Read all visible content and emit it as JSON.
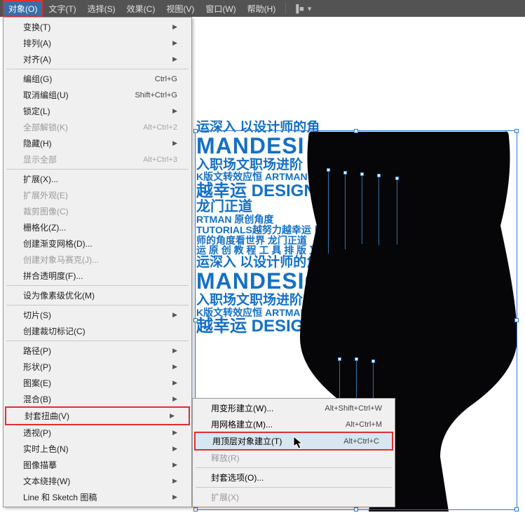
{
  "menubar": {
    "items": [
      {
        "label": "对象(O)",
        "active": true
      },
      {
        "label": "文字(T)"
      },
      {
        "label": "选择(S)"
      },
      {
        "label": "效果(C)"
      },
      {
        "label": "视图(V)"
      },
      {
        "label": "窗口(W)"
      },
      {
        "label": "帮助(H)"
      }
    ]
  },
  "dropdown": {
    "items": [
      {
        "label": "变换(T)",
        "sub": true
      },
      {
        "label": "排列(A)",
        "sub": true
      },
      {
        "label": "对齐(A)",
        "sub": true
      },
      {
        "sep": true
      },
      {
        "label": "编组(G)",
        "shortcut": "Ctrl+G"
      },
      {
        "label": "取消编组(U)",
        "shortcut": "Shift+Ctrl+G"
      },
      {
        "label": "锁定(L)",
        "sub": true
      },
      {
        "label": "全部解锁(K)",
        "shortcut": "Alt+Ctrl+2",
        "disabled": true
      },
      {
        "label": "隐藏(H)",
        "sub": true
      },
      {
        "label": "显示全部",
        "shortcut": "Alt+Ctrl+3",
        "disabled": true
      },
      {
        "sep": true
      },
      {
        "label": "扩展(X)..."
      },
      {
        "label": "扩展外观(E)",
        "disabled": true
      },
      {
        "label": "裁剪图像(C)",
        "disabled": true
      },
      {
        "label": "栅格化(Z)..."
      },
      {
        "label": "创建渐变网格(D)..."
      },
      {
        "label": "创建对象马赛克(J)...",
        "disabled": true
      },
      {
        "label": "拼合透明度(F)..."
      },
      {
        "sep": true
      },
      {
        "label": "设为像素级优化(M)"
      },
      {
        "sep": true
      },
      {
        "label": "切片(S)",
        "sub": true
      },
      {
        "label": "创建裁切标记(C)"
      },
      {
        "sep": true
      },
      {
        "label": "路径(P)",
        "sub": true
      },
      {
        "label": "形状(P)",
        "sub": true
      },
      {
        "label": "图案(E)",
        "sub": true
      },
      {
        "label": "混合(B)",
        "sub": true
      },
      {
        "label": "封套扭曲(V)",
        "sub": true,
        "highlight": true
      },
      {
        "label": "透视(P)",
        "sub": true
      },
      {
        "label": "实时上色(N)",
        "sub": true
      },
      {
        "label": "图像描摹",
        "sub": true
      },
      {
        "label": "文本绕排(W)",
        "sub": true
      },
      {
        "label": "Line 和 Sketch 图稿",
        "sub": true
      }
    ]
  },
  "submenu": {
    "items": [
      {
        "label": "用变形建立(W)...",
        "shortcut": "Alt+Shift+Ctrl+W"
      },
      {
        "label": "用网格建立(M)...",
        "shortcut": "Alt+Ctrl+M"
      },
      {
        "label": "用顶层对象建立(T)",
        "shortcut": "Alt+Ctrl+C",
        "highlight": true
      },
      {
        "label": "释放(R)",
        "disabled": true
      },
      {
        "sep": true
      },
      {
        "label": "封套选项(O)..."
      },
      {
        "sep": true
      },
      {
        "label": "扩展(X)",
        "disabled": true
      }
    ]
  },
  "artwork": {
    "lines": [
      {
        "cls": "tc-b",
        "text": "运深入 以设计师的角"
      },
      {
        "cls": "tc-a",
        "text": "MANDESI"
      },
      {
        "cls": "tc-b",
        "text": "入职场文职场进阶"
      },
      {
        "cls": "tc-c",
        "text": "K版文转效应恒 ARTMAN"
      },
      {
        "cls": "tc-d",
        "text": "越幸运 DESIGN"
      },
      {
        "cls": "tc-e",
        "text": "龙门正道"
      },
      {
        "cls": "tc-c",
        "text": "RTMAN 原创角度"
      },
      {
        "cls": "tc-c",
        "text": "TUTORIALS越努力越幸运 日畫设计"
      },
      {
        "cls": "tc-c",
        "text": "师的角度看世界 龙门正道"
      },
      {
        "cls": "tc-c",
        "text": "运 原 创 教 程 工 具 排 版 又"
      },
      {
        "cls": "tc-b",
        "text": "运深入 以设计师的角"
      },
      {
        "cls": "tc-a",
        "text": "MANDESIG"
      },
      {
        "cls": "tc-b",
        "text": "入职场文职场进阶 庞"
      },
      {
        "cls": "tc-c",
        "text": "K版文转效应恒 ARTMAN W"
      },
      {
        "cls": "tc-d",
        "text": "越幸运 DESIGN  门"
      }
    ]
  }
}
